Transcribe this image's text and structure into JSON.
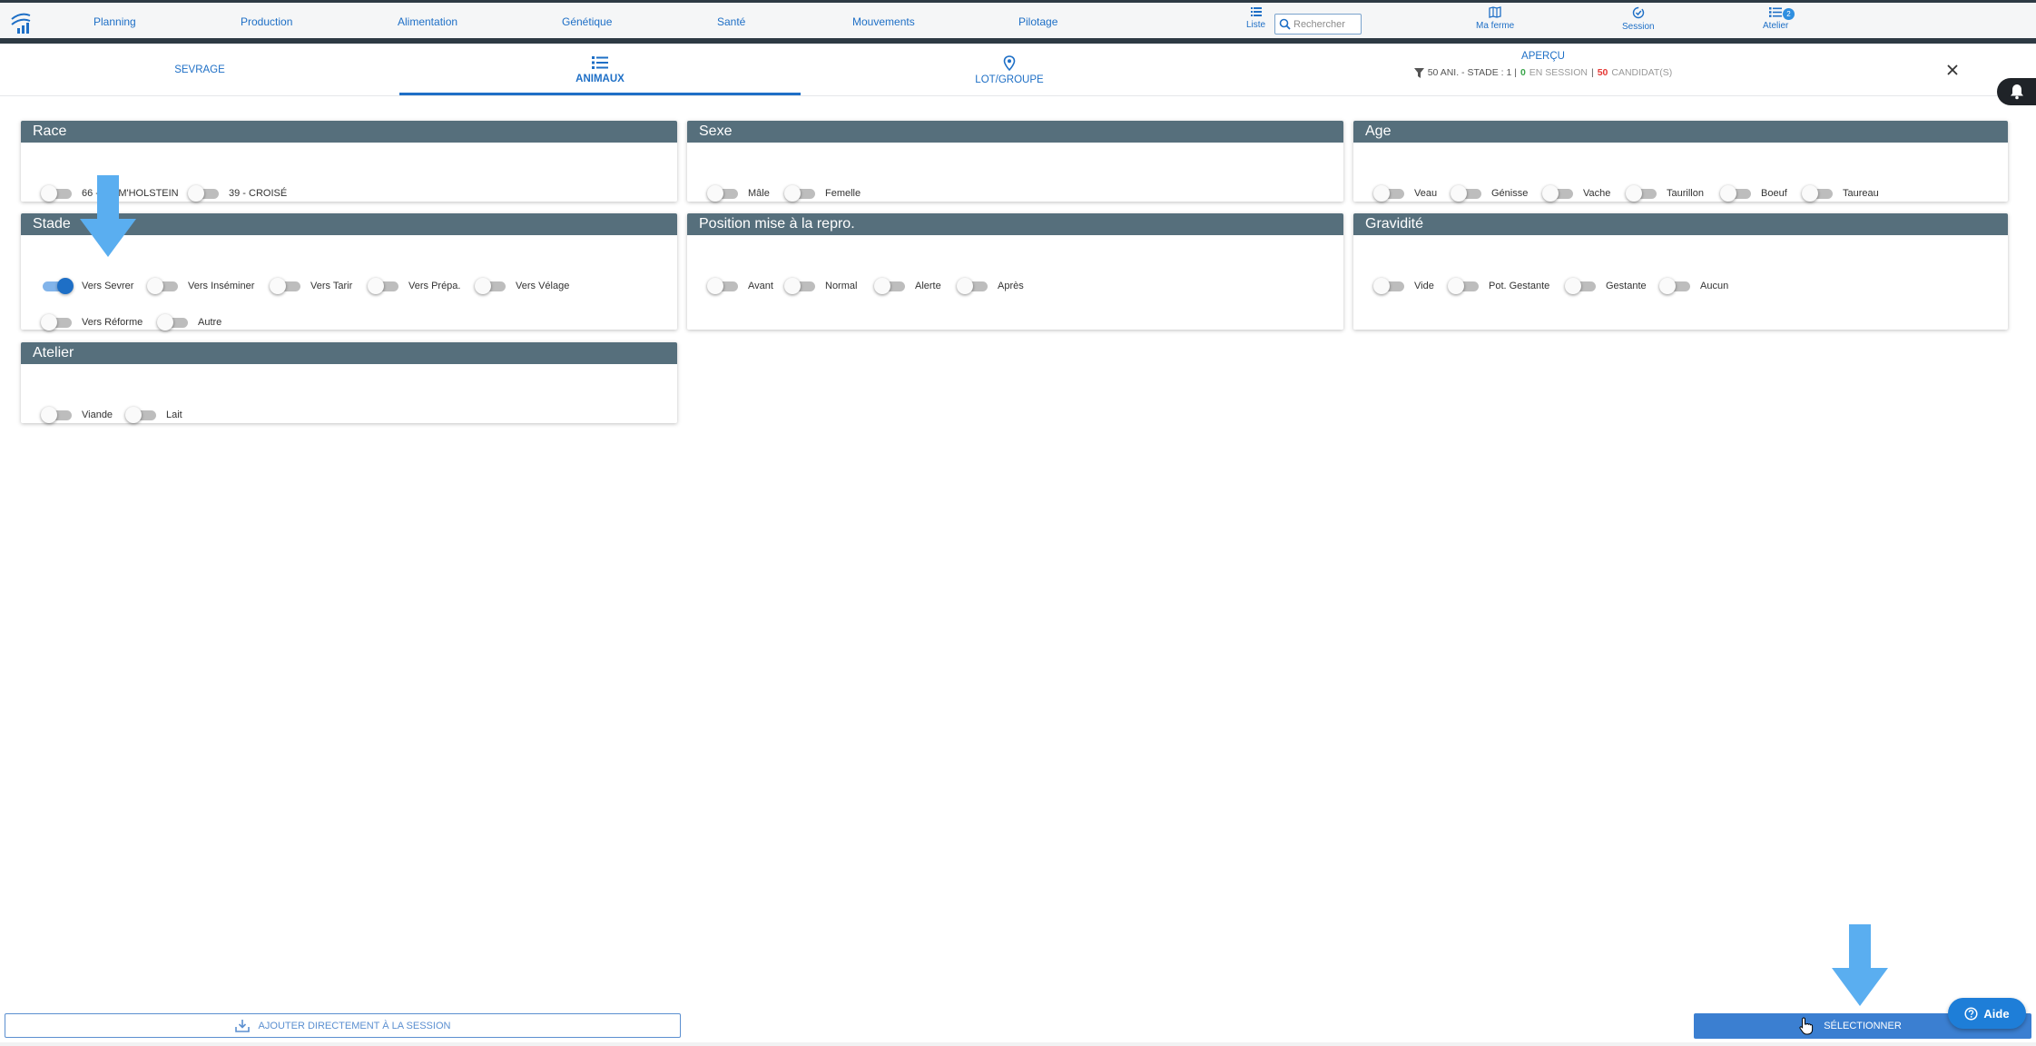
{
  "nav": {
    "items": [
      "Planning",
      "Production",
      "Alimentation",
      "Génétique",
      "Santé",
      "Mouvements",
      "Pilotage"
    ],
    "liste_label": "Liste",
    "search_placeholder": "Rechercher",
    "ma_ferme_label": "Ma ferme",
    "session_label": "Session",
    "atelier_label": "Atelier",
    "atelier_badge": "2"
  },
  "tabs": {
    "sevrage": "SEVRAGE",
    "animaux": "ANIMAUX",
    "lot_groupe": "LOT/GROUPE",
    "apercu_title": "APERÇU",
    "apercu_filter": "50 ANI. - STADE : 1 |",
    "apercu_in_session_count": "0",
    "apercu_in_session_label": "EN SESSION",
    "apercu_sep": "|",
    "apercu_candidats_count": "50",
    "apercu_candidats_label": "CANDIDAT(S)"
  },
  "cards": {
    "race": {
      "title": "Race",
      "options": [
        {
          "label": "66 - PRIM'HOLSTEIN",
          "on": false
        },
        {
          "label": "39 - CROISÉ",
          "on": false
        }
      ]
    },
    "sexe": {
      "title": "Sexe",
      "options": [
        {
          "label": "Mâle",
          "on": false
        },
        {
          "label": "Femelle",
          "on": false
        }
      ]
    },
    "age": {
      "title": "Age",
      "options": [
        {
          "label": "Veau",
          "on": false
        },
        {
          "label": "Génisse",
          "on": false
        },
        {
          "label": "Vache",
          "on": false
        },
        {
          "label": "Taurillon",
          "on": false
        },
        {
          "label": "Boeuf",
          "on": false
        },
        {
          "label": "Taureau",
          "on": false
        }
      ]
    },
    "stade": {
      "title": "Stade",
      "options": [
        {
          "label": "Vers Sevrer",
          "on": true
        },
        {
          "label": "Vers Inséminer",
          "on": false
        },
        {
          "label": "Vers Tarir",
          "on": false
        },
        {
          "label": "Vers Prépa.",
          "on": false
        },
        {
          "label": "Vers Vélage",
          "on": false
        },
        {
          "label": "Vers Réforme",
          "on": false
        },
        {
          "label": "Autre",
          "on": false
        }
      ]
    },
    "position": {
      "title": "Position mise à la repro.",
      "options": [
        {
          "label": "Avant",
          "on": false
        },
        {
          "label": "Normal",
          "on": false
        },
        {
          "label": "Alerte",
          "on": false
        },
        {
          "label": "Après",
          "on": false
        }
      ]
    },
    "gravidite": {
      "title": "Gravidité",
      "options": [
        {
          "label": "Vide",
          "on": false
        },
        {
          "label": "Pot. Gestante",
          "on": false
        },
        {
          "label": "Gestante",
          "on": false
        },
        {
          "label": "Aucun",
          "on": false
        }
      ]
    },
    "atelier": {
      "title": "Atelier",
      "options": [
        {
          "label": "Viande",
          "on": false
        },
        {
          "label": "Lait",
          "on": false
        }
      ]
    }
  },
  "actions": {
    "add_to_session": "AJOUTER DIRECTEMENT À LA SESSION",
    "select": "SÉLECTIONNER",
    "aide": "Aide"
  },
  "colors": {
    "accent": "#1e6fc6",
    "card_header": "#566f7c",
    "topbar_dark": "#2e3a44",
    "annotation_arrow": "#5aaef0"
  }
}
